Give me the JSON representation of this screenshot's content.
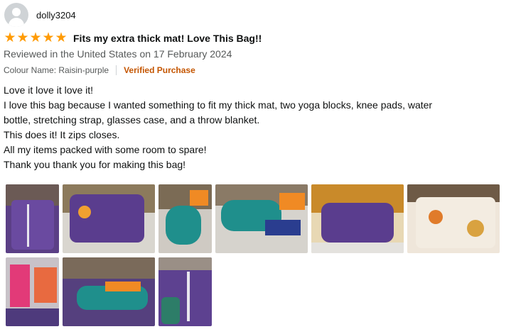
{
  "review": {
    "username": "dolly3204",
    "rating": 5,
    "title": "Fits my extra thick mat! Love This Bag!!",
    "date_line": "Reviewed in the United States on 17 February 2024",
    "colour_name": "Colour Name: Raisin-purple",
    "verified": "Verified Purchase",
    "body": [
      "Love it love it love it!",
      "I love this bag because I wanted something to fit my thick mat, two yoga blocks, knee pads, water",
      "bottle, stretching strap, glasses case, and a throw blanket.",
      "This does it! It zips closes.",
      "All my items packed with some room to spare!",
      "Thank you thank you for making this bag!"
    ]
  },
  "icons": {
    "avatar": "default-user-avatar-icon",
    "star": "filled-star-icon"
  },
  "colors": {
    "star": "#ff9b05",
    "verified": "#c45500",
    "secondary_text": "#565959"
  },
  "photos_count": 9
}
